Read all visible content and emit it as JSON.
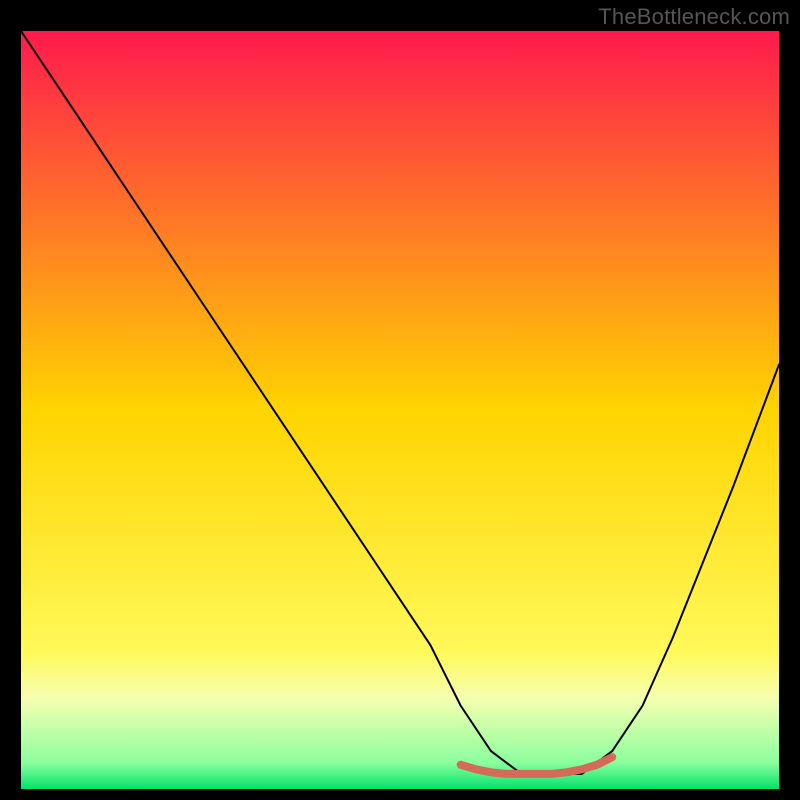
{
  "watermark": "TheBottleneck.com",
  "chart_data": {
    "type": "line",
    "title": "",
    "xlabel": "",
    "ylabel": "",
    "xlim": [
      0,
      100
    ],
    "ylim": [
      0,
      100
    ],
    "grid": false,
    "legend": false,
    "background_gradient": {
      "stops": [
        {
          "pos": 0.0,
          "color": "#ff1a4d"
        },
        {
          "pos": 0.5,
          "color": "#ffd400"
        },
        {
          "pos": 0.82,
          "color": "#fff95a"
        },
        {
          "pos": 0.88,
          "color": "#f6ffb0"
        },
        {
          "pos": 0.965,
          "color": "#8cff9e"
        },
        {
          "pos": 1.0,
          "color": "#00e36a"
        }
      ]
    },
    "series": [
      {
        "name": "bottleneck-curve",
        "stroke": "#000000",
        "x": [
          0,
          6,
          12,
          18,
          24,
          30,
          36,
          42,
          48,
          54,
          58,
          62,
          66,
          70,
          74,
          78,
          82,
          86,
          90,
          94,
          100
        ],
        "y": [
          100,
          91,
          82,
          73,
          64,
          55,
          46,
          37,
          28,
          19,
          11,
          5,
          2,
          2,
          2,
          5,
          11,
          20,
          30,
          40,
          56
        ]
      },
      {
        "name": "valley-highlight",
        "stroke": "#d36a5a",
        "stroke_width": 8,
        "x": [
          58,
          60,
          62,
          64,
          66,
          68,
          70,
          72,
          74,
          76,
          78
        ],
        "y": [
          3.2,
          2.6,
          2.2,
          2.0,
          2.0,
          2.0,
          2.0,
          2.2,
          2.6,
          3.2,
          4.2
        ]
      }
    ]
  }
}
